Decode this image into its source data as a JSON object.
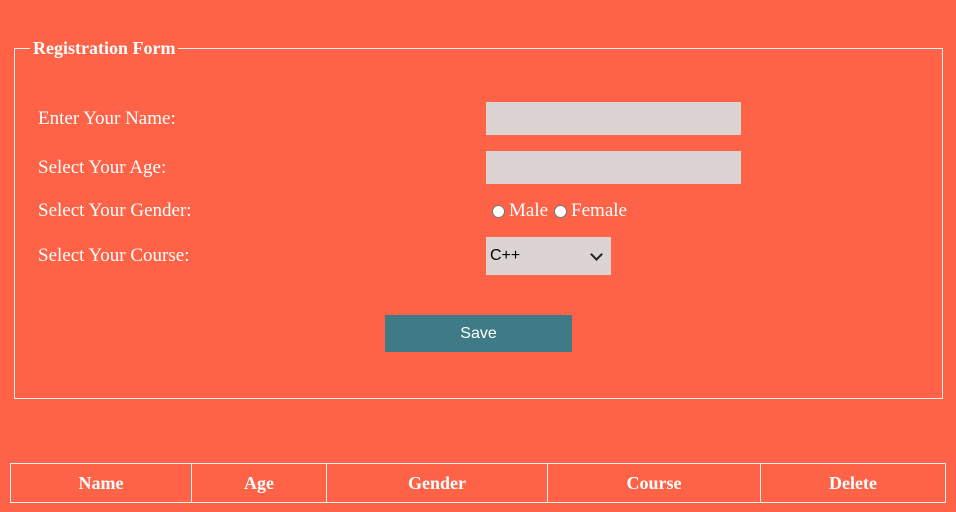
{
  "form": {
    "legend": "Registration Form",
    "name_label": "Enter Your Name:",
    "name_value": "",
    "age_label": "Select Your Age:",
    "age_value": "",
    "gender_label": "Select Your Gender:",
    "gender_options": [
      "Male",
      "Female"
    ],
    "course_label": "Select Your Course:",
    "course_selected": "C++",
    "save_label": "Save"
  },
  "table": {
    "headers": [
      "Name",
      "Age",
      "Gender",
      "Course",
      "Delete"
    ]
  },
  "colors": {
    "background": "#ff6347",
    "button": "#3f7b86",
    "input": "#dcd4d3"
  }
}
